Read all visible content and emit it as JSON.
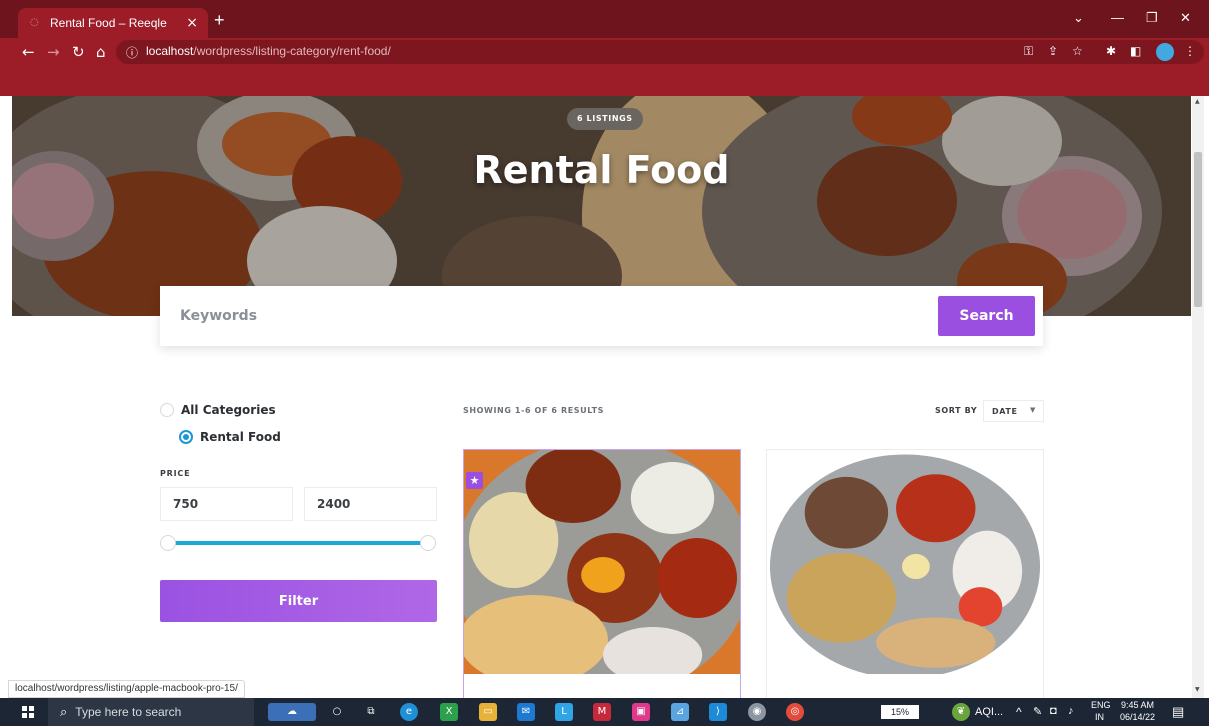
{
  "browser": {
    "tab_title": "Rental Food – Reeqle",
    "url_host": "localhost",
    "url_path": "/wordpress/listing-category/rent-food/"
  },
  "hero": {
    "badge": "6 LISTINGS",
    "title": "Rental Food"
  },
  "search": {
    "placeholder": "Keywords",
    "button_label": "Search"
  },
  "sidebar": {
    "categories": [
      {
        "label": "All Categories",
        "checked": false
      },
      {
        "label": "Rental Food",
        "checked": true
      }
    ],
    "price_label": "PRICE",
    "price_min": "750",
    "price_max": "2400",
    "filter_label": "Filter"
  },
  "results": {
    "count_text": "SHOWING 1-6 OF 6 RESULTS",
    "sort_label": "SORT BY",
    "sort_value": "DATE"
  },
  "status_url": "localhost/wordpress/listing/apple-macbook-pro-15/",
  "taskbar": {
    "search_placeholder": "Type here to search",
    "battery": "15%",
    "weather": "AQI...",
    "lang_top": "ENG",
    "lang_bottom": "IN",
    "time": "9:45 AM",
    "date": "06/14/22"
  },
  "colors": {
    "browser_frame": "#9c1c27",
    "accent_purple": "#9b4fe0",
    "slider_blue": "#1aa8d6"
  }
}
